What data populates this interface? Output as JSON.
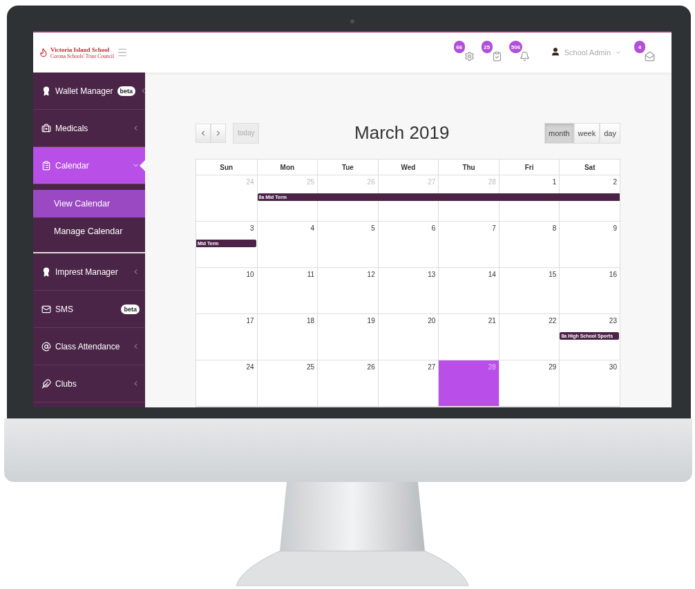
{
  "header": {
    "logo": {
      "title": "Victoria Island School",
      "subtitle": "Corona Schools' Trust Council"
    },
    "notifications": [
      {
        "count": "66"
      },
      {
        "count": "25"
      },
      {
        "count": "506"
      }
    ],
    "user": {
      "name": "School Admin"
    },
    "messages": {
      "count": "4"
    }
  },
  "sidebar": {
    "items": [
      {
        "label": "Wallet Manager",
        "badge": "beta",
        "expanded": false,
        "selected": false
      },
      {
        "label": "Medicals",
        "expanded": false,
        "selected": false
      },
      {
        "label": "Calendar",
        "expanded": true,
        "selected": true,
        "children": [
          {
            "label": "View Calendar",
            "selected": true
          },
          {
            "label": "Manage Calendar",
            "selected": false
          }
        ]
      },
      {
        "label": "Imprest Manager",
        "expanded": false,
        "selected": false
      },
      {
        "label": "SMS",
        "badge": "beta",
        "selected": false
      },
      {
        "label": "Class Attendance",
        "expanded": false,
        "selected": false
      },
      {
        "label": "Clubs",
        "expanded": false,
        "selected": false
      }
    ]
  },
  "calendar": {
    "title": "March 2019",
    "today_button": {
      "label": "today",
      "disabled": true
    },
    "views": [
      {
        "label": "month",
        "selected": true
      },
      {
        "label": "week",
        "selected": false
      },
      {
        "label": "day",
        "selected": false
      }
    ],
    "weekdays": [
      "Sun",
      "Mon",
      "Tue",
      "Wed",
      "Thu",
      "Fri",
      "Sat"
    ],
    "weeks": [
      {
        "days": [
          {
            "date": "24",
            "muted": true,
            "today": false
          },
          {
            "date": "25",
            "muted": true,
            "today": false,
            "event": {
              "title": "8a Mid Term",
              "kind": "start"
            }
          },
          {
            "date": "26",
            "muted": true,
            "today": false
          },
          {
            "date": "27",
            "muted": true,
            "today": false
          },
          {
            "date": "28",
            "muted": true,
            "today": false
          },
          {
            "date": "1",
            "muted": false,
            "today": false
          },
          {
            "date": "2",
            "muted": false,
            "today": false
          }
        ]
      },
      {
        "days": [
          {
            "date": "3",
            "muted": false,
            "today": false,
            "event": {
              "title": "Mid Term",
              "kind": "end"
            }
          },
          {
            "date": "4",
            "muted": false,
            "today": false
          },
          {
            "date": "5",
            "muted": false,
            "today": false
          },
          {
            "date": "6",
            "muted": false,
            "today": false
          },
          {
            "date": "7",
            "muted": false,
            "today": false
          },
          {
            "date": "8",
            "muted": false,
            "today": false
          },
          {
            "date": "9",
            "muted": false,
            "today": false
          }
        ]
      },
      {
        "days": [
          {
            "date": "10",
            "muted": false,
            "today": false
          },
          {
            "date": "11",
            "muted": false,
            "today": false
          },
          {
            "date": "12",
            "muted": false,
            "today": false
          },
          {
            "date": "13",
            "muted": false,
            "today": false
          },
          {
            "date": "14",
            "muted": false,
            "today": false
          },
          {
            "date": "15",
            "muted": false,
            "today": false
          },
          {
            "date": "16",
            "muted": false,
            "today": false
          }
        ]
      },
      {
        "days": [
          {
            "date": "17",
            "muted": false,
            "today": false
          },
          {
            "date": "18",
            "muted": false,
            "today": false
          },
          {
            "date": "19",
            "muted": false,
            "today": false
          },
          {
            "date": "20",
            "muted": false,
            "today": false
          },
          {
            "date": "21",
            "muted": false,
            "today": false
          },
          {
            "date": "22",
            "muted": false,
            "today": false
          },
          {
            "date": "23",
            "muted": false,
            "today": false,
            "event": {
              "title": "8a High School Sports",
              "kind": "single"
            }
          }
        ]
      },
      {
        "days": [
          {
            "date": "24",
            "muted": false,
            "today": false
          },
          {
            "date": "25",
            "muted": false,
            "today": false
          },
          {
            "date": "26",
            "muted": false,
            "today": false
          },
          {
            "date": "27",
            "muted": false,
            "today": false
          },
          {
            "date": "28",
            "muted": false,
            "today": true
          },
          {
            "date": "29",
            "muted": false,
            "today": false
          },
          {
            "date": "30",
            "muted": false,
            "today": false
          }
        ]
      }
    ]
  }
}
